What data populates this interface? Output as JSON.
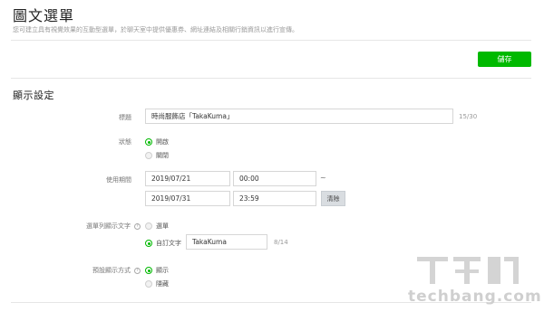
{
  "header": {
    "title": "圖文選單",
    "description": "您可建立具有視覺效果的互動型選單，於聊天室中提供優惠券、網址連結及相關行銷資訊以進行宣傳。"
  },
  "toolbar": {
    "save_label": "儲存"
  },
  "section": {
    "title": "顯示設定"
  },
  "form": {
    "title_label": "標題",
    "title_value": "時尚服飾店「TakaKuma」",
    "title_counter": "15/30",
    "status_label": "狀態",
    "status_options": [
      {
        "label": "開啟",
        "selected": true
      },
      {
        "label": "關閉",
        "selected": false
      }
    ],
    "period_label": "使用期間",
    "start_date": "2019/07/21",
    "start_time": "00:00",
    "range_separator": "~",
    "end_date": "2019/07/31",
    "end_time": "23:59",
    "clear_label": "清除",
    "menu_text_label": "選單列顯示文字",
    "menu_text_options": [
      {
        "label": "選單",
        "selected": false
      },
      {
        "label": "自訂文字",
        "selected": true
      }
    ],
    "menu_text_value": "TakaKuma",
    "menu_text_counter": "8/14",
    "default_display_label": "預設顯示方式",
    "default_display_options": [
      {
        "label": "顯示",
        "selected": true
      },
      {
        "label": "隱藏",
        "selected": false
      }
    ]
  },
  "watermark": {
    "text": "techbang.com"
  },
  "colors": {
    "accent": "#00b900",
    "clear_button": "#d9dde1"
  },
  "icons": {
    "help": "question-circle-icon"
  }
}
